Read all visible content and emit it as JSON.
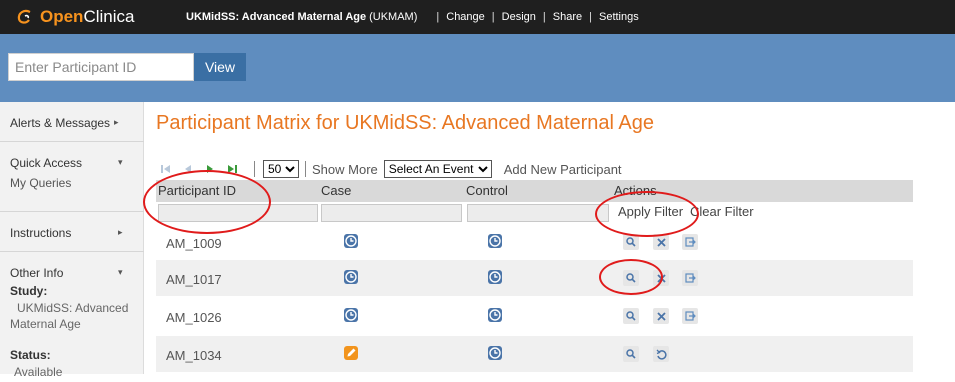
{
  "app": {
    "logo_open": "Open",
    "logo_clinica": "Clinica",
    "study_title": "UKMidSS: Advanced Maternal Age",
    "study_code": "(UKMAM)",
    "nav": [
      {
        "label": "Change"
      },
      {
        "label": "Design"
      },
      {
        "label": "Share"
      },
      {
        "label": "Settings"
      }
    ],
    "separator": "|"
  },
  "search": {
    "placeholder": "Enter Participant ID",
    "view_label": "View"
  },
  "sidebar": {
    "alerts": "Alerts & Messages",
    "quick_access": "Quick Access",
    "my_queries": "My Queries",
    "instructions": "Instructions",
    "other_info": "Other Info",
    "study_label": "Study:",
    "study_value_1": "UKMidSS: Advanced",
    "study_value_2": "Maternal Age",
    "status_label": "Status:",
    "status_value": "Available"
  },
  "main": {
    "title": "Participant Matrix for UKMidSS: Advanced Maternal Age",
    "per_page": "50",
    "show_more": "Show More",
    "event_select": "Select An Event",
    "add_new": "Add New Participant",
    "columns": [
      "Participant ID",
      "Case",
      "Control",
      "Actions"
    ],
    "apply_filter": "Apply Filter",
    "clear_filter": "Clear Filter",
    "rows": [
      {
        "id": "AM_1009",
        "case": "scheduled",
        "control": "scheduled",
        "actions": [
          "view",
          "remove",
          "signout"
        ]
      },
      {
        "id": "AM_1017",
        "case": "scheduled",
        "control": "scheduled",
        "actions": [
          "view",
          "remove",
          "signout"
        ]
      },
      {
        "id": "AM_1026",
        "case": "scheduled",
        "control": "scheduled",
        "actions": [
          "view",
          "remove",
          "signout"
        ]
      },
      {
        "id": "AM_1034",
        "case": "data-entry-started",
        "control": "scheduled",
        "actions": [
          "view",
          "restore"
        ]
      }
    ]
  },
  "colors": {
    "topbar": "#1f1f1f",
    "blueband": "#5f8dbf",
    "title_orange": "#e87722",
    "scheduled_icon": "#4a74a8",
    "started_icon": "#f2941d",
    "annotation_red": "#e01b1b"
  }
}
